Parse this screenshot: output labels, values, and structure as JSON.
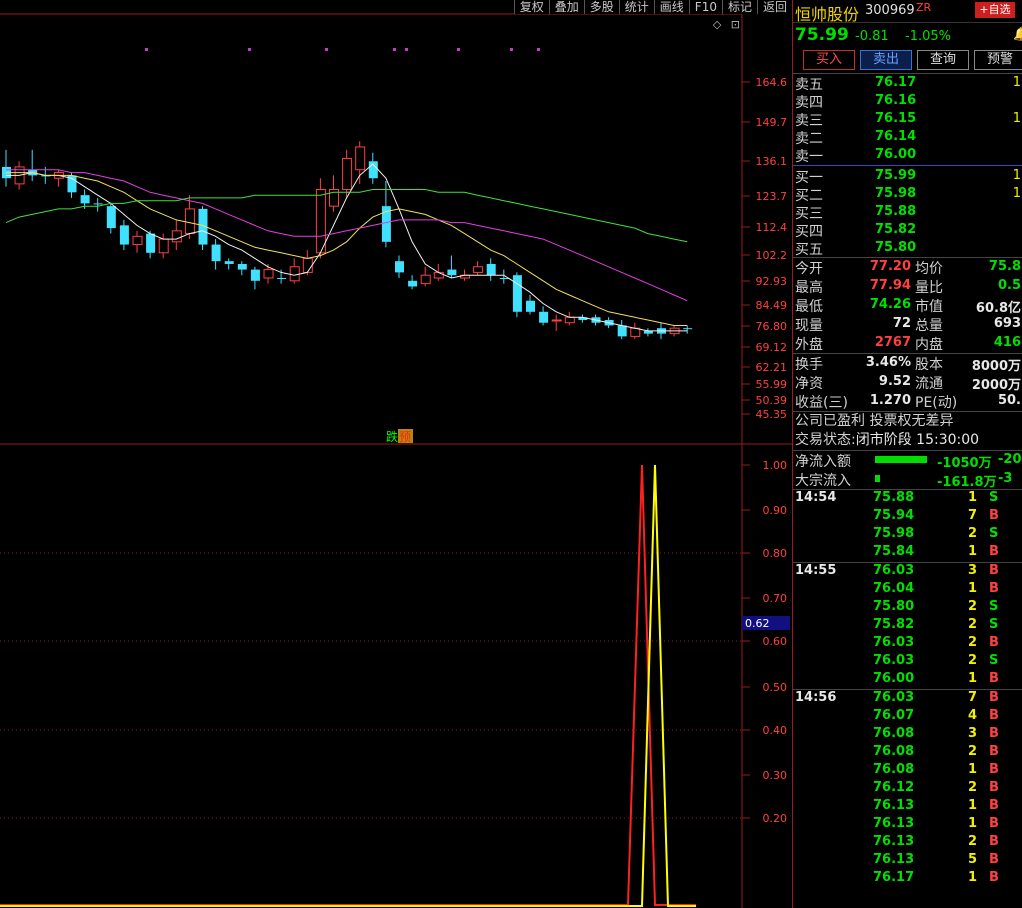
{
  "toolbar": [
    "复权",
    "叠加",
    "多股",
    "统计",
    "画线",
    "F10",
    "标记",
    "返回"
  ],
  "small_icons": [
    "◇",
    "⊡"
  ],
  "signal_labels": {
    "die": "跌",
    "yu": "预"
  },
  "upper_axis": [
    "164.6",
    "149.7",
    "136.1",
    "123.7",
    "112.4",
    "102.2",
    "92.93",
    "84.49",
    "76.80",
    "69.12",
    "62.21",
    "55.99",
    "50.39",
    "45.35"
  ],
  "lower_axis": [
    "1.00",
    "0.90",
    "0.80",
    "0.70",
    "0.60",
    "0.50",
    "0.40",
    "0.30",
    "0.20"
  ],
  "cursor_value": "0.62",
  "colors": {
    "up": "#ff4040",
    "down": "#40e0ff",
    "ma5": "#f0f0f0",
    "ma10": "#f0e060",
    "ma20": "#e040e0",
    "ma60": "#40e040",
    "red_line": "#ff2020",
    "yellow_line": "#ffff00"
  },
  "chart_data": {
    "type": "candlestick",
    "candles": [
      {
        "o": 130,
        "c": 134,
        "h": 140,
        "l": 127,
        "up": false
      },
      {
        "o": 128,
        "c": 134,
        "h": 136,
        "l": 126,
        "up": true
      },
      {
        "o": 133,
        "c": 131,
        "h": 140,
        "l": 129,
        "up": false
      },
      {
        "o": 131,
        "c": 131,
        "h": 134,
        "l": 128,
        "up": false
      },
      {
        "o": 130,
        "c": 132,
        "h": 133,
        "l": 127,
        "up": true
      },
      {
        "o": 131,
        "c": 125,
        "h": 132,
        "l": 123,
        "up": false
      },
      {
        "o": 124,
        "c": 121,
        "h": 126,
        "l": 119,
        "up": false
      },
      {
        "o": 121,
        "c": 121,
        "h": 123,
        "l": 118,
        "up": false
      },
      {
        "o": 120,
        "c": 112,
        "h": 121,
        "l": 110,
        "up": false
      },
      {
        "o": 113,
        "c": 106,
        "h": 115,
        "l": 104,
        "up": false
      },
      {
        "o": 106,
        "c": 109,
        "h": 111,
        "l": 103,
        "up": true
      },
      {
        "o": 110,
        "c": 103,
        "h": 111,
        "l": 101,
        "up": false
      },
      {
        "o": 103,
        "c": 108,
        "h": 110,
        "l": 101,
        "up": true
      },
      {
        "o": 107,
        "c": 111,
        "h": 115,
        "l": 104,
        "up": true
      },
      {
        "o": 110,
        "c": 119,
        "h": 124,
        "l": 108,
        "up": true
      },
      {
        "o": 119,
        "c": 106,
        "h": 120,
        "l": 104,
        "up": false
      },
      {
        "o": 106,
        "c": 100,
        "h": 108,
        "l": 97,
        "up": false
      },
      {
        "o": 100,
        "c": 99,
        "h": 101,
        "l": 97,
        "up": false
      },
      {
        "o": 99,
        "c": 97,
        "h": 100,
        "l": 95,
        "up": false
      },
      {
        "o": 97,
        "c": 93,
        "h": 98,
        "l": 90,
        "up": false
      },
      {
        "o": 94,
        "c": 97,
        "h": 99,
        "l": 92,
        "up": true
      },
      {
        "o": 94,
        "c": 94,
        "h": 97,
        "l": 92,
        "up": false
      },
      {
        "o": 93,
        "c": 98,
        "h": 101,
        "l": 92,
        "up": true
      },
      {
        "o": 96,
        "c": 101,
        "h": 104,
        "l": 95,
        "up": true
      },
      {
        "o": 103,
        "c": 126,
        "h": 130,
        "l": 101,
        "up": true
      },
      {
        "o": 120,
        "c": 126,
        "h": 131,
        "l": 118,
        "up": true
      },
      {
        "o": 126,
        "c": 137,
        "h": 140,
        "l": 123,
        "up": true
      },
      {
        "o": 133,
        "c": 141,
        "h": 143,
        "l": 128,
        "up": true
      },
      {
        "o": 136,
        "c": 130,
        "h": 139,
        "l": 128,
        "up": false
      },
      {
        "o": 120,
        "c": 107,
        "h": 129,
        "l": 105,
        "up": false
      },
      {
        "o": 100,
        "c": 96,
        "h": 102,
        "l": 94,
        "up": false
      },
      {
        "o": 93,
        "c": 91,
        "h": 95,
        "l": 90,
        "up": false
      },
      {
        "o": 92,
        "c": 95,
        "h": 98,
        "l": 91,
        "up": true
      },
      {
        "o": 94,
        "c": 96,
        "h": 99,
        "l": 93,
        "up": true
      },
      {
        "o": 97,
        "c": 95,
        "h": 102,
        "l": 94,
        "up": false
      },
      {
        "o": 94,
        "c": 95,
        "h": 97,
        "l": 93,
        "up": true
      },
      {
        "o": 96,
        "c": 98,
        "h": 100,
        "l": 95,
        "up": true
      },
      {
        "o": 99,
        "c": 95,
        "h": 101,
        "l": 93,
        "up": false
      },
      {
        "o": 94,
        "c": 94,
        "h": 97,
        "l": 92,
        "up": false
      },
      {
        "o": 95,
        "c": 82,
        "h": 96,
        "l": 80,
        "up": false
      },
      {
        "o": 86,
        "c": 82,
        "h": 88,
        "l": 81,
        "up": false
      },
      {
        "o": 82,
        "c": 78,
        "h": 84,
        "l": 77,
        "up": false
      },
      {
        "o": 79,
        "c": 79,
        "h": 81,
        "l": 75,
        "up": true
      },
      {
        "o": 78,
        "c": 80,
        "h": 82,
        "l": 77,
        "up": true
      },
      {
        "o": 80,
        "c": 79,
        "h": 81,
        "l": 78,
        "up": false
      },
      {
        "o": 80,
        "c": 78,
        "h": 81,
        "l": 77,
        "up": false
      },
      {
        "o": 79,
        "c": 77,
        "h": 80,
        "l": 76,
        "up": false
      },
      {
        "o": 77,
        "c": 73,
        "h": 79,
        "l": 72,
        "up": false
      },
      {
        "o": 73,
        "c": 76,
        "h": 78,
        "l": 72,
        "up": true
      },
      {
        "o": 75,
        "c": 74,
        "h": 76,
        "l": 73,
        "up": false
      },
      {
        "o": 76,
        "c": 74,
        "h": 78,
        "l": 72,
        "up": false
      },
      {
        "o": 74,
        "c": 76,
        "h": 77,
        "l": 73,
        "up": true
      },
      {
        "o": 76,
        "c": 76,
        "h": 77,
        "l": 74,
        "up": false
      }
    ],
    "ma_lines": {
      "ma5": [
        131,
        131,
        132,
        131,
        131,
        130,
        127,
        124,
        121,
        117,
        113,
        110,
        108,
        108,
        110,
        111,
        109,
        106,
        104,
        101,
        98,
        96,
        95,
        96,
        103,
        113,
        123,
        131,
        135,
        130,
        119,
        107,
        99,
        96,
        94,
        95,
        95,
        95,
        95,
        92,
        89,
        85,
        82,
        80,
        80,
        79,
        78,
        77,
        76,
        75,
        75,
        75,
        75
      ],
      "ma10": [
        132,
        132,
        132,
        131,
        131,
        131,
        130,
        129,
        127,
        125,
        122,
        119,
        117,
        115,
        114,
        113,
        111,
        109,
        107,
        105,
        104,
        103,
        102,
        101,
        102,
        104,
        107,
        112,
        116,
        118,
        119,
        118,
        117,
        115,
        113,
        110,
        107,
        104,
        102,
        99,
        96,
        93,
        90,
        88,
        86,
        84,
        82,
        81,
        80,
        79,
        78,
        77,
        77
      ],
      "ma20": [
        133,
        133,
        133,
        133,
        133,
        132,
        132,
        131,
        130,
        129,
        127,
        125,
        124,
        123,
        122,
        121,
        119,
        117,
        115,
        113,
        111,
        110,
        109,
        109,
        109,
        110,
        111,
        112,
        113,
        114,
        115,
        115,
        115,
        115,
        114,
        114,
        113,
        112,
        111,
        110,
        109,
        108,
        106,
        104,
        102,
        100,
        98,
        96,
        94,
        92,
        90,
        88,
        86
      ],
      "ma60": [
        114,
        116,
        117,
        118,
        119,
        119,
        120,
        120,
        121,
        121,
        122,
        122,
        122,
        122,
        123,
        123,
        123,
        123,
        123,
        124,
        124,
        124,
        124,
        124,
        124,
        125,
        125,
        125,
        126,
        126,
        126,
        126,
        126,
        125,
        125,
        125,
        124,
        123,
        122,
        121,
        120,
        119,
        118,
        117,
        116,
        115,
        114,
        113,
        112,
        110,
        109,
        108,
        107
      ]
    }
  },
  "stock": {
    "name": "恒帅股份",
    "code": "300969",
    "zr": "ZR",
    "add": "+自选",
    "price": "75.99",
    "change": "-0.81",
    "pct": "-1.05%"
  },
  "buttons": {
    "buy": "买入",
    "sell": "卖出",
    "query": "查询",
    "warn": "预警"
  },
  "asks": [
    {
      "label": "卖五",
      "price": "76.17",
      "vol": "1"
    },
    {
      "label": "卖四",
      "price": "76.16",
      "vol": ""
    },
    {
      "label": "卖三",
      "price": "76.15",
      "vol": "1"
    },
    {
      "label": "卖二",
      "price": "76.14",
      "vol": ""
    },
    {
      "label": "卖一",
      "price": "76.00",
      "vol": ""
    }
  ],
  "bids": [
    {
      "label": "买一",
      "price": "75.99",
      "vol": "1"
    },
    {
      "label": "买二",
      "price": "75.98",
      "vol": "1"
    },
    {
      "label": "买三",
      "price": "75.88",
      "vol": ""
    },
    {
      "label": "买四",
      "price": "75.82",
      "vol": ""
    },
    {
      "label": "买五",
      "price": "75.80",
      "vol": ""
    }
  ],
  "stats1": [
    {
      "l1": "今开",
      "v1": "77.20",
      "c1": "red",
      "l2": "均价",
      "v2": "75.8",
      "c2": "green"
    },
    {
      "l1": "最高",
      "v1": "77.94",
      "c1": "red",
      "l2": "量比",
      "v2": "0.5",
      "c2": "green"
    },
    {
      "l1": "最低",
      "v1": "74.26",
      "c1": "green",
      "l2": "市值",
      "v2": "60.8亿",
      "c2": "white"
    },
    {
      "l1": "现量",
      "v1": "72",
      "c1": "white",
      "l2": "总量",
      "v2": "693",
      "c2": "white"
    },
    {
      "l1": "外盘",
      "v1": "2767",
      "c1": "red",
      "l2": "内盘",
      "v2": "416",
      "c2": "green"
    }
  ],
  "stats2": [
    {
      "l1": "换手",
      "v1": "3.46%",
      "c1": "white",
      "l2": "股本",
      "v2": "8000万",
      "c2": "white"
    },
    {
      "l1": "净资",
      "v1": "9.52",
      "c1": "white",
      "l2": "流通",
      "v2": "2000万",
      "c2": "white"
    },
    {
      "l1": "收益(三)",
      "v1": "1.270",
      "c1": "white",
      "l2": "PE(动)",
      "v2": "50.",
      "c2": "white"
    }
  ],
  "info": {
    "company": "公司已盈利 投票权无差异",
    "status_label": "交易状态:",
    "status": "闭市阶段 15:30:00"
  },
  "flows": [
    {
      "label": "净流入额",
      "value": "-1050万",
      "value2": "-20",
      "bar_fraction": 1.0
    },
    {
      "label": "大宗流入",
      "value": "-161.8万",
      "value2": "-3",
      "bar_fraction": 0.1
    }
  ],
  "ticks": [
    {
      "time": "14:54",
      "price": "75.88",
      "qty": "1",
      "side": "S"
    },
    {
      "time": "",
      "price": "75.94",
      "qty": "7",
      "side": "B"
    },
    {
      "time": "",
      "price": "75.98",
      "qty": "2",
      "side": "S"
    },
    {
      "time": "",
      "price": "75.84",
      "qty": "1",
      "side": "B"
    },
    {
      "time": "14:55",
      "price": "76.03",
      "qty": "3",
      "side": "B"
    },
    {
      "time": "",
      "price": "76.04",
      "qty": "1",
      "side": "B"
    },
    {
      "time": "",
      "price": "75.80",
      "qty": "2",
      "side": "S"
    },
    {
      "time": "",
      "price": "75.82",
      "qty": "2",
      "side": "S"
    },
    {
      "time": "",
      "price": "76.03",
      "qty": "2",
      "side": "B"
    },
    {
      "time": "",
      "price": "76.03",
      "qty": "2",
      "side": "S"
    },
    {
      "time": "",
      "price": "76.00",
      "qty": "1",
      "side": "B"
    },
    {
      "time": "14:56",
      "price": "76.03",
      "qty": "7",
      "side": "B"
    },
    {
      "time": "",
      "price": "76.07",
      "qty": "4",
      "side": "B"
    },
    {
      "time": "",
      "price": "76.08",
      "qty": "3",
      "side": "B"
    },
    {
      "time": "",
      "price": "76.08",
      "qty": "2",
      "side": "B"
    },
    {
      "time": "",
      "price": "76.08",
      "qty": "1",
      "side": "B"
    },
    {
      "time": "",
      "price": "76.12",
      "qty": "2",
      "side": "B"
    },
    {
      "time": "",
      "price": "76.13",
      "qty": "1",
      "side": "B"
    },
    {
      "time": "",
      "price": "76.13",
      "qty": "1",
      "side": "B"
    },
    {
      "time": "",
      "price": "76.13",
      "qty": "2",
      "side": "B"
    },
    {
      "time": "",
      "price": "76.13",
      "qty": "5",
      "side": "B"
    },
    {
      "time": "",
      "price": "76.17",
      "qty": "1",
      "side": "B"
    }
  ]
}
